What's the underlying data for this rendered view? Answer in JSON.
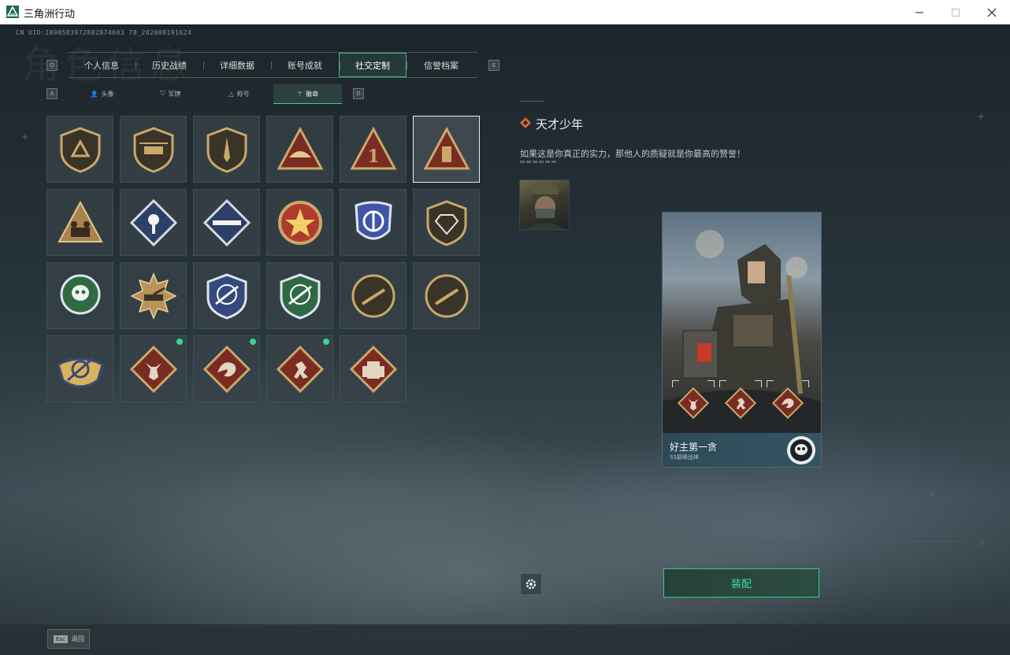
{
  "window": {
    "title": "三角洲行动",
    "minimize_icon": "minimize-icon",
    "maximize_icon": "maximize-icon",
    "close_icon": "close-icon"
  },
  "page": {
    "watermark_title": "角色信息",
    "uid": "CN UID:1890583972882874603 78_202608191624"
  },
  "nav": {
    "left_key": "Q",
    "right_key": "E",
    "tabs": [
      {
        "label": "个人信息",
        "active": false
      },
      {
        "label": "历史战绩",
        "active": false
      },
      {
        "label": "详细数据",
        "active": false
      },
      {
        "label": "账号成就",
        "active": false
      },
      {
        "label": "社交定制",
        "active": true
      },
      {
        "label": "信誉档案",
        "active": false
      }
    ]
  },
  "subnav": {
    "left_key": "A",
    "right_key": "D",
    "tabs": [
      {
        "label": "头像",
        "icon": "person-icon",
        "glyph": "👤",
        "active": false
      },
      {
        "label": "军牌",
        "icon": "dogtag-icon",
        "glyph": "⛉",
        "active": false
      },
      {
        "label": "称号",
        "icon": "title-icon",
        "glyph": "△",
        "active": false
      },
      {
        "label": "徽章",
        "icon": "badge-icon",
        "glyph": "⚚",
        "active": true
      }
    ]
  },
  "badges": [
    {
      "icon": "triangle-shield-badge-icon",
      "selected": false,
      "new": false
    },
    {
      "icon": "helicopter-shield-badge-icon",
      "selected": false,
      "new": false
    },
    {
      "icon": "dagger-shield-badge-icon",
      "selected": false,
      "new": false
    },
    {
      "icon": "wing-triangle-badge-icon",
      "selected": false,
      "new": false
    },
    {
      "icon": "number-one-triangle-badge-icon",
      "selected": false,
      "new": false
    },
    {
      "icon": "usb-triangle-badge-icon",
      "selected": true,
      "new": false
    },
    {
      "icon": "soldiers-triangle-badge-icon",
      "selected": false,
      "new": false
    },
    {
      "icon": "rose-diamond-badge-icon",
      "selected": false,
      "new": false
    },
    {
      "icon": "missile-diamond-badge-icon",
      "selected": false,
      "new": false
    },
    {
      "icon": "star-medal-badge-icon",
      "selected": false,
      "new": false
    },
    {
      "icon": "blue-police-badge-icon",
      "selected": false,
      "new": false
    },
    {
      "icon": "gem-shield-badge-icon",
      "selected": false,
      "new": false
    },
    {
      "icon": "green-skull-badge-icon",
      "selected": false,
      "new": false
    },
    {
      "icon": "tank-sun-badge-icon",
      "selected": false,
      "new": false
    },
    {
      "icon": "blue-crosshair-rifle-badge-icon",
      "selected": false,
      "new": false
    },
    {
      "icon": "green-crosshair-rifle-badge-icon",
      "selected": false,
      "new": false
    },
    {
      "icon": "smg-circle-badge-icon",
      "selected": false,
      "new": false
    },
    {
      "icon": "sniper-circle-badge-icon",
      "selected": false,
      "new": false
    },
    {
      "icon": "gold-wings-crosshair-badge-icon",
      "selected": false,
      "new": false
    },
    {
      "icon": "wolf-diamond-badge-icon",
      "selected": false,
      "new": true
    },
    {
      "icon": "dragon-diamond-badge-icon",
      "selected": false,
      "new": true
    },
    {
      "icon": "runner-diamond-badge-icon",
      "selected": false,
      "new": true
    },
    {
      "icon": "vest-diamond-badge-icon",
      "selected": false,
      "new": false
    }
  ],
  "detail": {
    "name": "天才少年",
    "name_icon": "diamond-marker-icon",
    "description": "如果这是你真正的实力，那他人的质疑就是你最高的赞誉！",
    "owner_avatar_icon": "operator-avatar-icon"
  },
  "card": {
    "player_name": "好主第一贪",
    "subtitle": "S5巅峰战神",
    "rank_icon": "skull-emblem-icon",
    "slots": [
      "wolf-diamond-badge-icon",
      "runner-diamond-badge-icon",
      "dragon-diamond-badge-icon"
    ]
  },
  "actions": {
    "settings_icon": "gear-icon",
    "equip_label": "装配",
    "esc_key": "Esc",
    "esc_label": "返回"
  },
  "colors": {
    "accent": "#3fdca6",
    "active_tab_border": "#3fb89a",
    "new_dot": "#39d48a",
    "badge_gold": "#c9a86a",
    "badge_red": "#7a2c22"
  }
}
